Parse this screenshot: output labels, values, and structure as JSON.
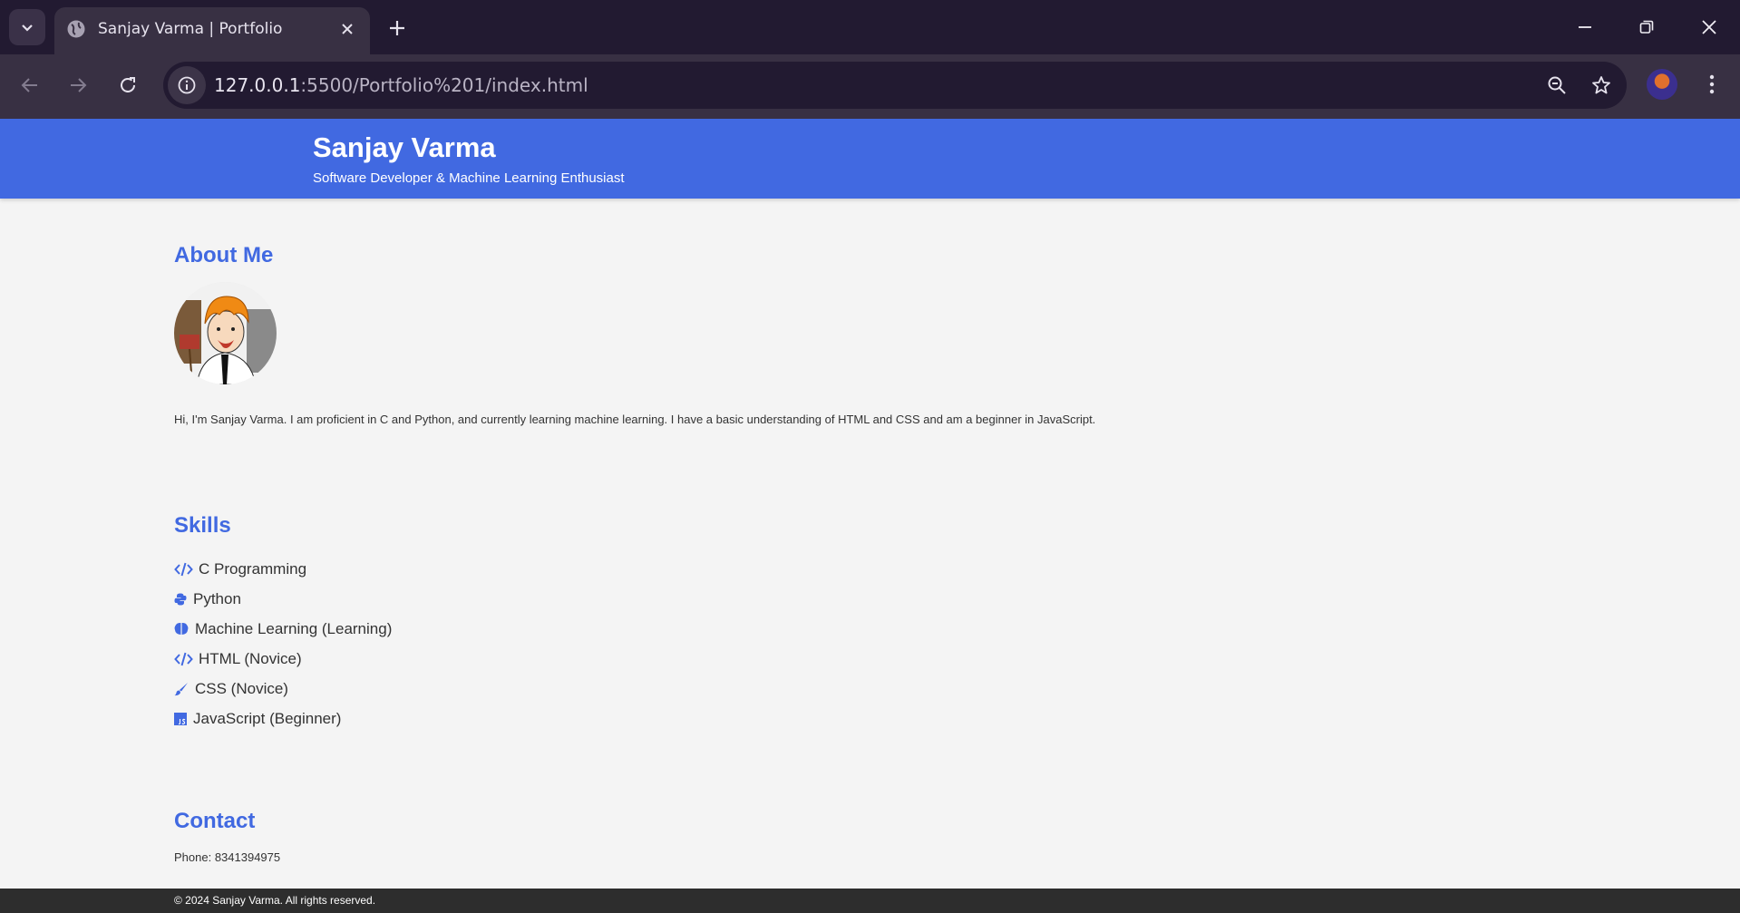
{
  "browser": {
    "tab_title": "Sanjay Varma | Portfolio",
    "url_host": "127.0.0.1",
    "url_rest": ":5500/Portfolio%201/index.html"
  },
  "header": {
    "name": "Sanjay Varma",
    "tagline": "Software Developer & Machine Learning Enthusiast"
  },
  "about": {
    "title": "About Me",
    "text": "Hi, I'm Sanjay Varma. I am proficient in C and Python, and currently learning machine learning. I have a basic understanding of HTML and CSS and am a beginner in JavaScript."
  },
  "skills": {
    "title": "Skills",
    "items": [
      {
        "label": "C Programming",
        "icon": "code-icon"
      },
      {
        "label": "Python",
        "icon": "python-icon"
      },
      {
        "label": "Machine Learning (Learning)",
        "icon": "brain-icon"
      },
      {
        "label": "HTML (Novice)",
        "icon": "code-icon"
      },
      {
        "label": "CSS (Novice)",
        "icon": "paintbrush-icon"
      },
      {
        "label": "JavaScript (Beginner)",
        "icon": "js-icon"
      }
    ]
  },
  "contact": {
    "title": "Contact",
    "phone": "Phone: 8341394975"
  },
  "footer": {
    "text": "© 2024 Sanjay Varma. All rights reserved."
  },
  "colors": {
    "accent": "#4169e1",
    "footer_bg": "#2d2d2d",
    "page_bg": "#f4f4f4"
  }
}
